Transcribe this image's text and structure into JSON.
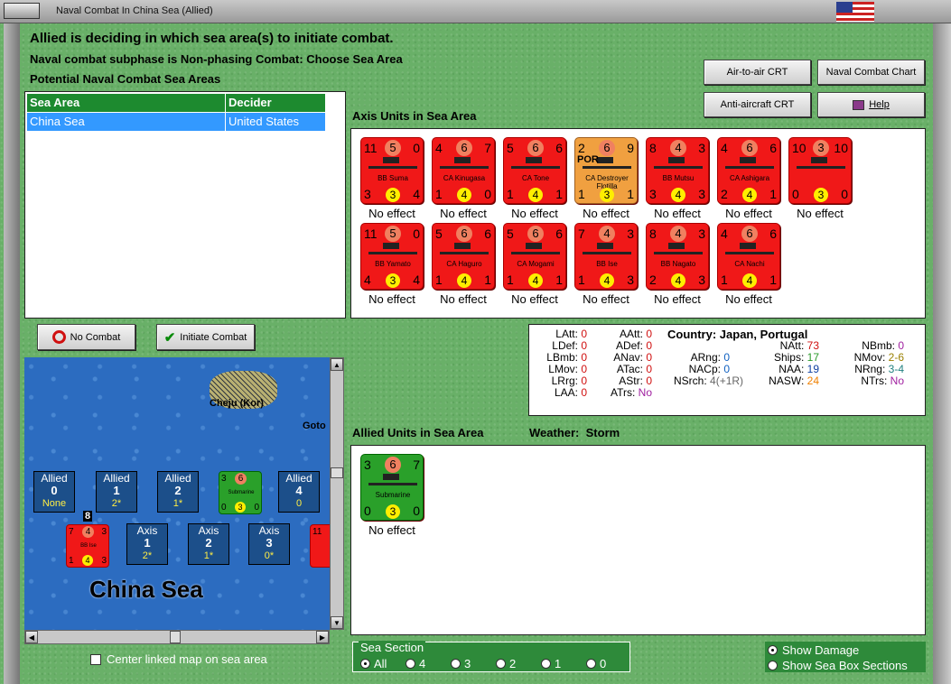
{
  "window": {
    "title": "Naval Combat In China Sea (Allied)"
  },
  "header": {
    "line1": "Allied is deciding in which sea area(s) to initiate combat.",
    "line2": "Naval combat subphase is Non-phasing Combat: Choose Sea Area",
    "line3": "Potential Naval Combat Sea Areas"
  },
  "buttons": {
    "air_to_air": "Air-to-air CRT",
    "naval_chart": "Naval Combat Chart",
    "anti_aircraft": "Anti-aircraft CRT",
    "help": "Help",
    "no_combat": "No Combat",
    "initiate_combat": "Initiate Combat"
  },
  "areas_table": {
    "headers": [
      "Sea Area",
      "Decider"
    ],
    "rows": [
      [
        "China Sea",
        "United States"
      ]
    ]
  },
  "axis_section": {
    "title": "Axis Units in Sea Area"
  },
  "axis_units": [
    {
      "tl": "11",
      "tm": "5",
      "tr": "0",
      "name": "BB Suma",
      "bl": "3",
      "bm": "3",
      "br": "4",
      "effect": "No effect",
      "color": "red"
    },
    {
      "tl": "4",
      "tm": "6",
      "tr": "7",
      "name": "CA Kinugasa",
      "bl": "1",
      "bm": "4",
      "br": "0",
      "effect": "No effect",
      "color": "red"
    },
    {
      "tl": "5",
      "tm": "6",
      "tr": "6",
      "name": "CA Tone",
      "bl": "1",
      "bm": "4",
      "br": "1",
      "effect": "No effect",
      "color": "red"
    },
    {
      "tl": "2",
      "tm": "6",
      "tr": "9",
      "name": "CA Destroyer Flotilla",
      "bl": "1",
      "bm": "3",
      "br": "1",
      "effect": "No effect",
      "color": "orange",
      "extra": "POR"
    },
    {
      "tl": "8",
      "tm": "4",
      "tr": "3",
      "name": "BB Mutsu",
      "bl": "3",
      "bm": "4",
      "br": "3",
      "effect": "No effect",
      "color": "red"
    },
    {
      "tl": "4",
      "tm": "6",
      "tr": "6",
      "name": "CA Ashigara",
      "bl": "2",
      "bm": "4",
      "br": "1",
      "effect": "No effect",
      "color": "red"
    },
    {
      "tl": "10",
      "tm": "3",
      "tr": "10",
      "name": "",
      "bl": "0",
      "bm": "3",
      "br": "0",
      "effect": "No effect",
      "color": "red"
    },
    {
      "tl": "11",
      "tm": "5",
      "tr": "0",
      "name": "BB Yamato",
      "bl": "4",
      "bm": "3",
      "br": "4",
      "effect": "No effect",
      "color": "red"
    },
    {
      "tl": "5",
      "tm": "6",
      "tr": "6",
      "name": "CA Haguro",
      "bl": "1",
      "bm": "4",
      "br": "1",
      "effect": "No effect",
      "color": "red"
    },
    {
      "tl": "5",
      "tm": "6",
      "tr": "6",
      "name": "CA Mogami",
      "bl": "1",
      "bm": "4",
      "br": "1",
      "effect": "No effect",
      "color": "red"
    },
    {
      "tl": "7",
      "tm": "4",
      "tr": "3",
      "name": "BB Ise",
      "bl": "1",
      "bm": "4",
      "br": "3",
      "effect": "No effect",
      "color": "red"
    },
    {
      "tl": "8",
      "tm": "4",
      "tr": "3",
      "name": "BB Nagato",
      "bl": "2",
      "bm": "4",
      "br": "3",
      "effect": "No effect",
      "color": "red"
    },
    {
      "tl": "4",
      "tm": "6",
      "tr": "6",
      "name": "CA Nachi",
      "bl": "1",
      "bm": "4",
      "br": "1",
      "effect": "No effect",
      "color": "red"
    }
  ],
  "stats": {
    "country_label": "Country:",
    "country_value": "Japan, Portugal",
    "col1": [
      [
        "LAtt:",
        "0"
      ],
      [
        "LDef:",
        "0"
      ],
      [
        "LBmb:",
        "0"
      ],
      [
        "LMov:",
        "0"
      ],
      [
        "LRrg:",
        "0"
      ],
      [
        "LAA:",
        "0"
      ]
    ],
    "col2": [
      [
        "AAtt:",
        "0"
      ],
      [
        "ADef:",
        "0"
      ],
      [
        "ANav:",
        "0"
      ],
      [
        "ATac:",
        "0"
      ],
      [
        "AStr:",
        "0"
      ],
      [
        "ATrs:",
        "No"
      ]
    ],
    "col3": [
      [
        "ARng:",
        "0"
      ],
      [
        "NACp:",
        "0"
      ],
      [
        "NSrch:",
        "4(+1R)"
      ]
    ],
    "col4": [
      [
        "NAtt:",
        "73"
      ],
      [
        "Ships:",
        "17"
      ],
      [
        "NAA:",
        "19"
      ],
      [
        "NASW:",
        "24"
      ]
    ],
    "col5": [
      [
        "NBmb:",
        "0"
      ],
      [
        "NMov:",
        "2-6"
      ],
      [
        "NRng:",
        "3-4"
      ],
      [
        "NTrs:",
        "No"
      ]
    ]
  },
  "allied_section": {
    "title": "Allied Units in Sea Area",
    "weather_label": "Weather:",
    "weather_value": "Storm"
  },
  "allied_units": [
    {
      "tl": "3",
      "tm": "6",
      "tr": "7",
      "name": "Submarine",
      "bl": "0",
      "bm": "3",
      "br": "0",
      "effect": "No effect",
      "color": "green"
    }
  ],
  "map": {
    "sea_name": "China Sea",
    "place1": "Cheju (Kor)",
    "place2": "Goto",
    "allied_boxes": [
      {
        "label": "Allied",
        "num": "0",
        "sub": "None"
      },
      {
        "label": "Allied",
        "num": "1",
        "sub": "2*"
      },
      {
        "label": "Allied",
        "num": "2",
        "sub": "1*"
      },
      {
        "label": "Allied",
        "num": "4",
        "sub": "0"
      }
    ],
    "axis_boxes": [
      {
        "label": "Axis",
        "num": "1",
        "sub": "2*"
      },
      {
        "label": "Axis",
        "num": "2",
        "sub": "1*"
      },
      {
        "label": "Axis",
        "num": "3",
        "sub": "0*"
      }
    ],
    "stack_count": "8",
    "sub_counter": {
      "tl": "3",
      "tm": "6",
      "name": "Submarine",
      "bl": "0",
      "bm": "3",
      "br": "0"
    },
    "ise_counter": {
      "tl": "7",
      "tm": "4",
      "tr": "3",
      "name": "BB Ise",
      "bl": "1",
      "bm": "4",
      "br": "3"
    },
    "edge_counter": {
      "tl": "11"
    }
  },
  "center_map_label": "Center linked map on sea area",
  "sea_section": {
    "title": "Sea Section",
    "options": [
      "All",
      "4",
      "3",
      "2",
      "1",
      "0"
    ],
    "selected": "All"
  },
  "view_options": {
    "show_damage": "Show Damage",
    "show_sea_box": "Show Sea Box Sections"
  }
}
